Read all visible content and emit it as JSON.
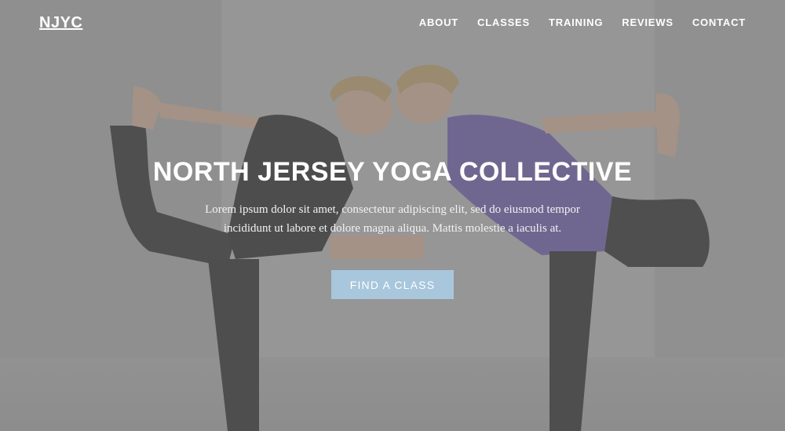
{
  "nav": {
    "brand": "NJYC",
    "items": [
      {
        "label": "ABOUT"
      },
      {
        "label": "CLASSES"
      },
      {
        "label": "TRAINING"
      },
      {
        "label": "REVIEWS"
      },
      {
        "label": "CONTACT"
      }
    ]
  },
  "hero": {
    "title": "NORTH JERSEY YOGA COLLECTIVE",
    "subtitle": "Lorem ipsum dolor sit amet, consectetur adipiscing elit, sed do eiusmod tempor incididunt ut labore et dolore magna aliqua. Mattis molestie a iaculis at.",
    "cta_label": "FIND A CLASS",
    "background_image": "two-women-dancer-pose-yoga-photo",
    "overlay_color": "#787878",
    "cta_color": "#a8c6dc"
  }
}
